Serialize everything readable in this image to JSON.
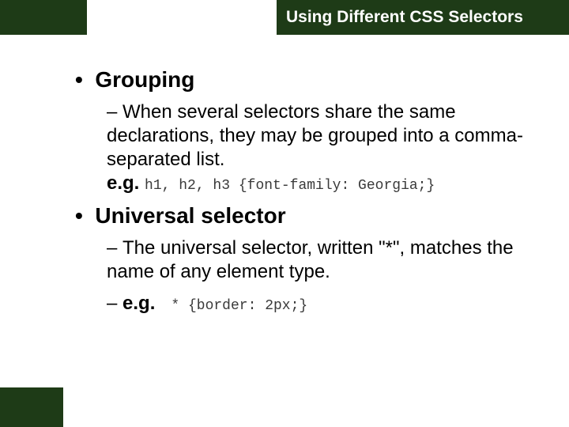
{
  "title": "Using Different CSS Selectors",
  "sections": [
    {
      "heading": "Grouping",
      "body": "When several selectors share the same declarations, they may be grouped into a comma-separated list.",
      "example_prefix": "e.g.",
      "example_code": "h1, h2, h3 {font-family: Georgia;}"
    },
    {
      "heading": "Universal selector",
      "body": "The universal selector, written \"*\", matches the name of any element type.",
      "example_prefix": "e.g.",
      "example_code": "* {border: 2px;}"
    }
  ]
}
